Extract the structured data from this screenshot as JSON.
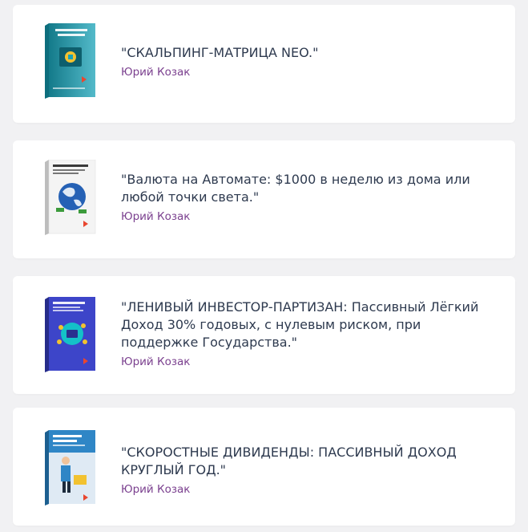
{
  "books": [
    {
      "title": "\"СКАЛЬПИНГ-МАТРИЦА NEO.\"",
      "author": "Юрий Козак",
      "cover_icon": "scalping-matrix-book-cover-icon",
      "cover_color": "#1aa3b8"
    },
    {
      "title": "\"Валюта на Автомате: $1000 в неделю из дома или любой точки света.\"",
      "author": "Юрий Козак",
      "cover_icon": "globe-money-book-cover-icon",
      "cover_color": "#f2f2f2"
    },
    {
      "title": "\"ЛЕНИВЫЙ ИНВЕСТОР-ПАРТИЗАН: Пассивный Лёгкий Доход 30% годовых, с нулевым риском, при поддержке Государства.\"",
      "author": "Юрий Козак",
      "cover_icon": "lazy-investor-book-cover-icon",
      "cover_color": "#3d45c9"
    },
    {
      "title": "\"СКОРОСТНЫЕ ДИВИДЕНДЫ: ПАССИВНЫЙ ДОХОД КРУГЛЫЙ ГОД.\"",
      "author": "Юрий Козак",
      "cover_icon": "fast-dividends-book-cover-icon",
      "cover_color": "#2f86c6"
    }
  ]
}
